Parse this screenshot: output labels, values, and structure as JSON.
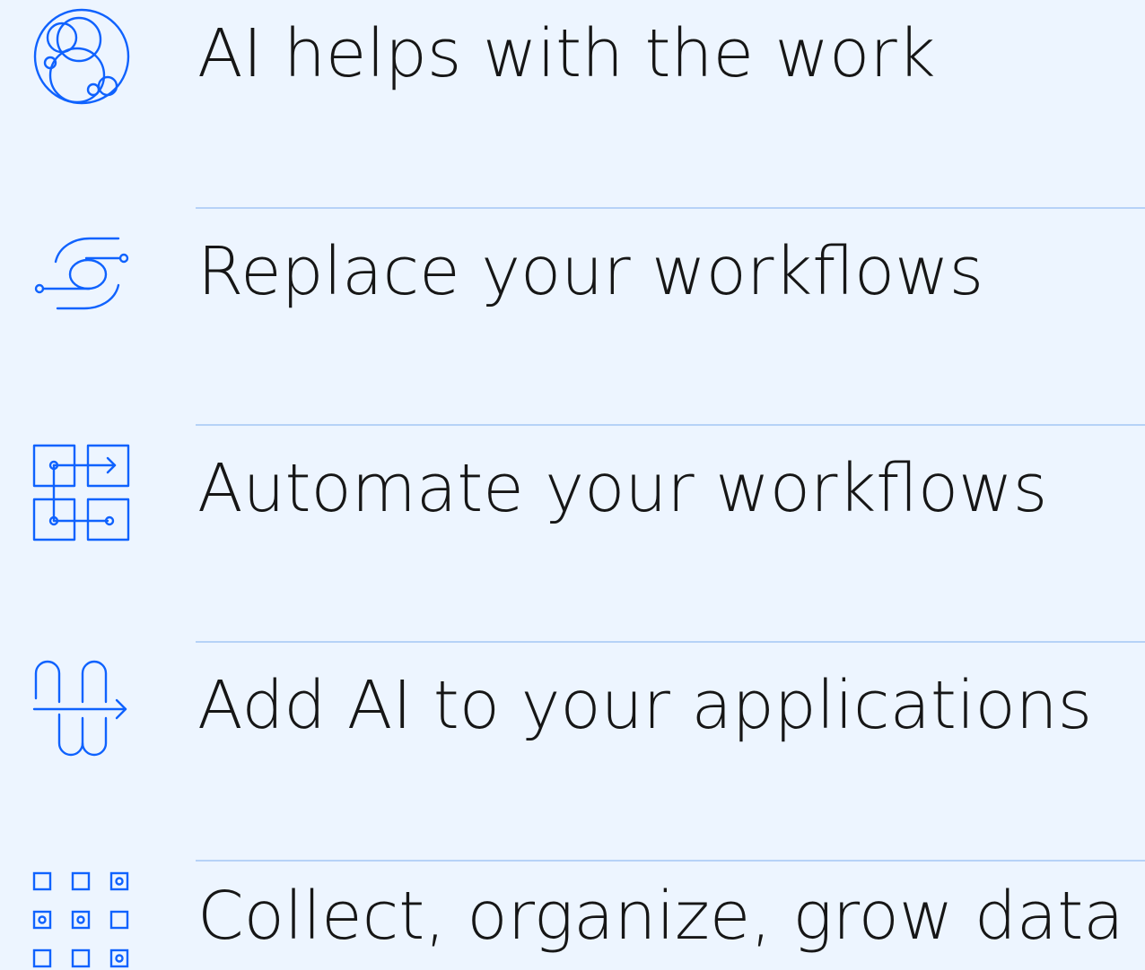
{
  "accent_color": "#0f62fe",
  "divider_color": "#b6d2f7",
  "background_color": "#edf5ff",
  "items": [
    {
      "label": "AI helps with the work",
      "icon": "bubbles-icon"
    },
    {
      "label": "Replace your workflows",
      "icon": "swap-flow-icon"
    },
    {
      "label": "Automate your workflows",
      "icon": "automation-grid-icon"
    },
    {
      "label": "Add AI to your applications",
      "icon": "app-integration-icon"
    },
    {
      "label": "Collect, organize, grow data",
      "icon": "data-grid-icon"
    }
  ]
}
